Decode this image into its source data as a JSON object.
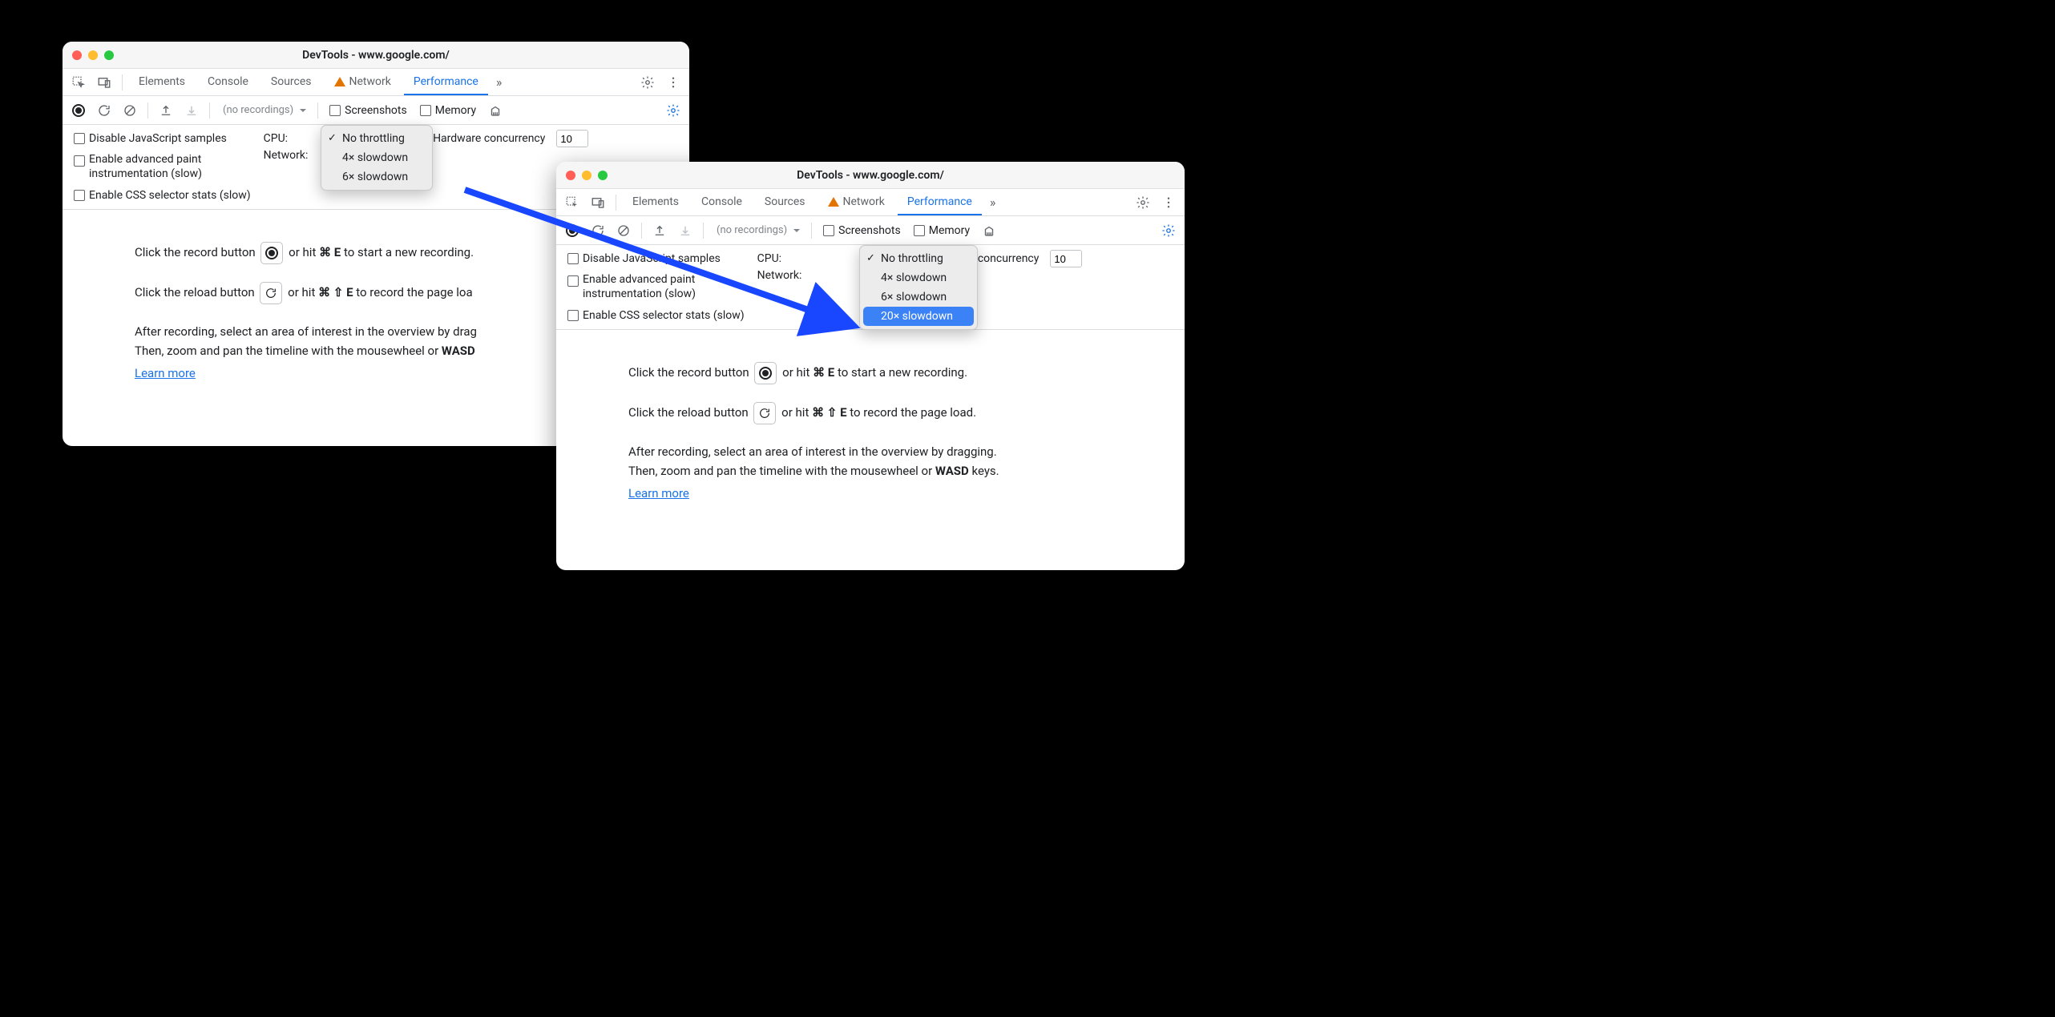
{
  "window_title": "DevTools - www.google.com/",
  "tabs": {
    "elements": "Elements",
    "console": "Console",
    "sources": "Sources",
    "network": "Network",
    "performance": "Performance"
  },
  "subbar": {
    "no_recordings": "(no recordings)",
    "screenshots": "Screenshots",
    "memory": "Memory"
  },
  "settings": {
    "disable_js": "Disable JavaScript samples",
    "adv_paint": "Enable advanced paint instrumentation (slow)",
    "css_stats": "Enable CSS selector stats (slow)",
    "cpu_label": "CPU:",
    "network_label": "Network:",
    "hw_concurrency": "Hardware concurrency",
    "hw_value": "10"
  },
  "cpu_dropdown_a": {
    "no_throttling": "No throttling",
    "x4": "4× slowdown",
    "x6": "6× slowdown"
  },
  "cpu_dropdown_b": {
    "no_throttling": "No throttling",
    "x4": "4× slowdown",
    "x6": "6× slowdown",
    "x20": "20× slowdown"
  },
  "instructions": {
    "line1_pre": "Click the record button ",
    "line1_mid": " or hit ",
    "line1_key": "⌘ E",
    "line1_end": " to start a new recording.",
    "line2_pre": "Click the reload button ",
    "line2_mid": " or hit ",
    "line2_key": "⌘ ⇧ E",
    "line2_end": " to record the page load.",
    "line3_a": "After recording, select an area of interest in the overview by dragging.",
    "line3_b_pre": "Then, zoom and pan the timeline with the mousewheel or ",
    "line3_b_bold": "WASD",
    "line3_b_end": " keys.",
    "learn_more": "Learn more"
  },
  "truncated": {
    "line1_end": " to start a new recording.",
    "line2_end": " to record the page loa",
    "line3_a": "After recording, select an area of interest in the overview by drag",
    "line3_b": "Then, zoom and pan the timeline with the mousewheel or "
  }
}
